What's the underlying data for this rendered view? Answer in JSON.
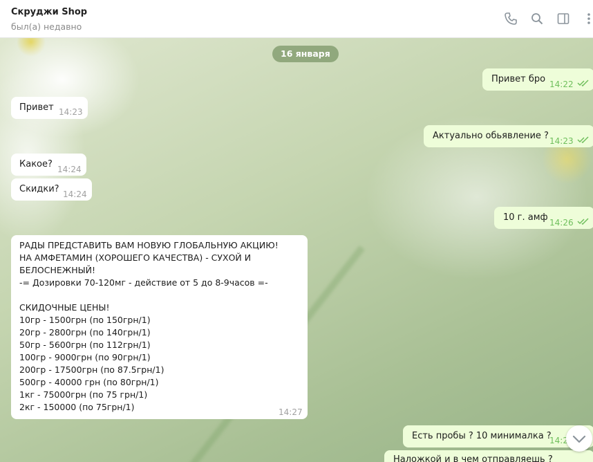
{
  "header": {
    "title": "Скруджи Shop",
    "status": "был(а) недавно",
    "icons": [
      "phone-icon",
      "search-icon",
      "sidebar-toggle-icon",
      "more-vertical-icon"
    ]
  },
  "chat": {
    "date_separator": "16 января",
    "messages": [
      {
        "dir": "out",
        "text": "Привет бро",
        "time": "14:22"
      },
      {
        "dir": "in",
        "text": "Привет",
        "time": "14:23"
      },
      {
        "dir": "out",
        "text": "Актуально обьявление ?",
        "time": "14:23"
      },
      {
        "dir": "in",
        "text": "Какое?",
        "time": "14:24"
      },
      {
        "dir": "in",
        "text": "Скидки?",
        "time": "14:24"
      },
      {
        "dir": "out",
        "text": "10 г. амф",
        "time": "14:26"
      },
      {
        "dir": "in",
        "text": "РАДЫ ПРЕДСТАВИТЬ ВАМ НОВУЮ ГЛОБАЛЬНУЮ АКЦИЮ!\nНА АМФЕТАМИН (ХОРОШЕГО КАЧЕСТВА) - СУХОЙ И\nБЕЛОСНЕЖНЫЙ!\n-= Дозировки 70-120мг - действие от 5 до 8-9часов =-\n\nСКИДОЧНЫЕ ЦЕНЫ!\n10гр - 1500грн (по 150грн/1)\n20гр - 2800грн (по 140грн/1)\n50гр - 5600грн (по 112грн/1)\n100гр - 9000грн (по 90грн/1)\n200гр - 17500грн (по 87.5грн/1)\n500гр - 40000 грн (по 80грн/1)\n1кг - 75000грн (по 75 грн/1)\n2кг - 150000 (по 75грн/1)",
        "time": "14:27"
      },
      {
        "dir": "out",
        "text": "Есть пробы ? 10 минималка ?",
        "time": "14:2"
      },
      {
        "dir": "out",
        "text": "Наложкой и в чем отправляешь ?",
        "time": ""
      }
    ]
  },
  "colors": {
    "incoming": "#ffffff",
    "outgoing": "#eefdd9",
    "accent_green": "#6fbf5c"
  }
}
